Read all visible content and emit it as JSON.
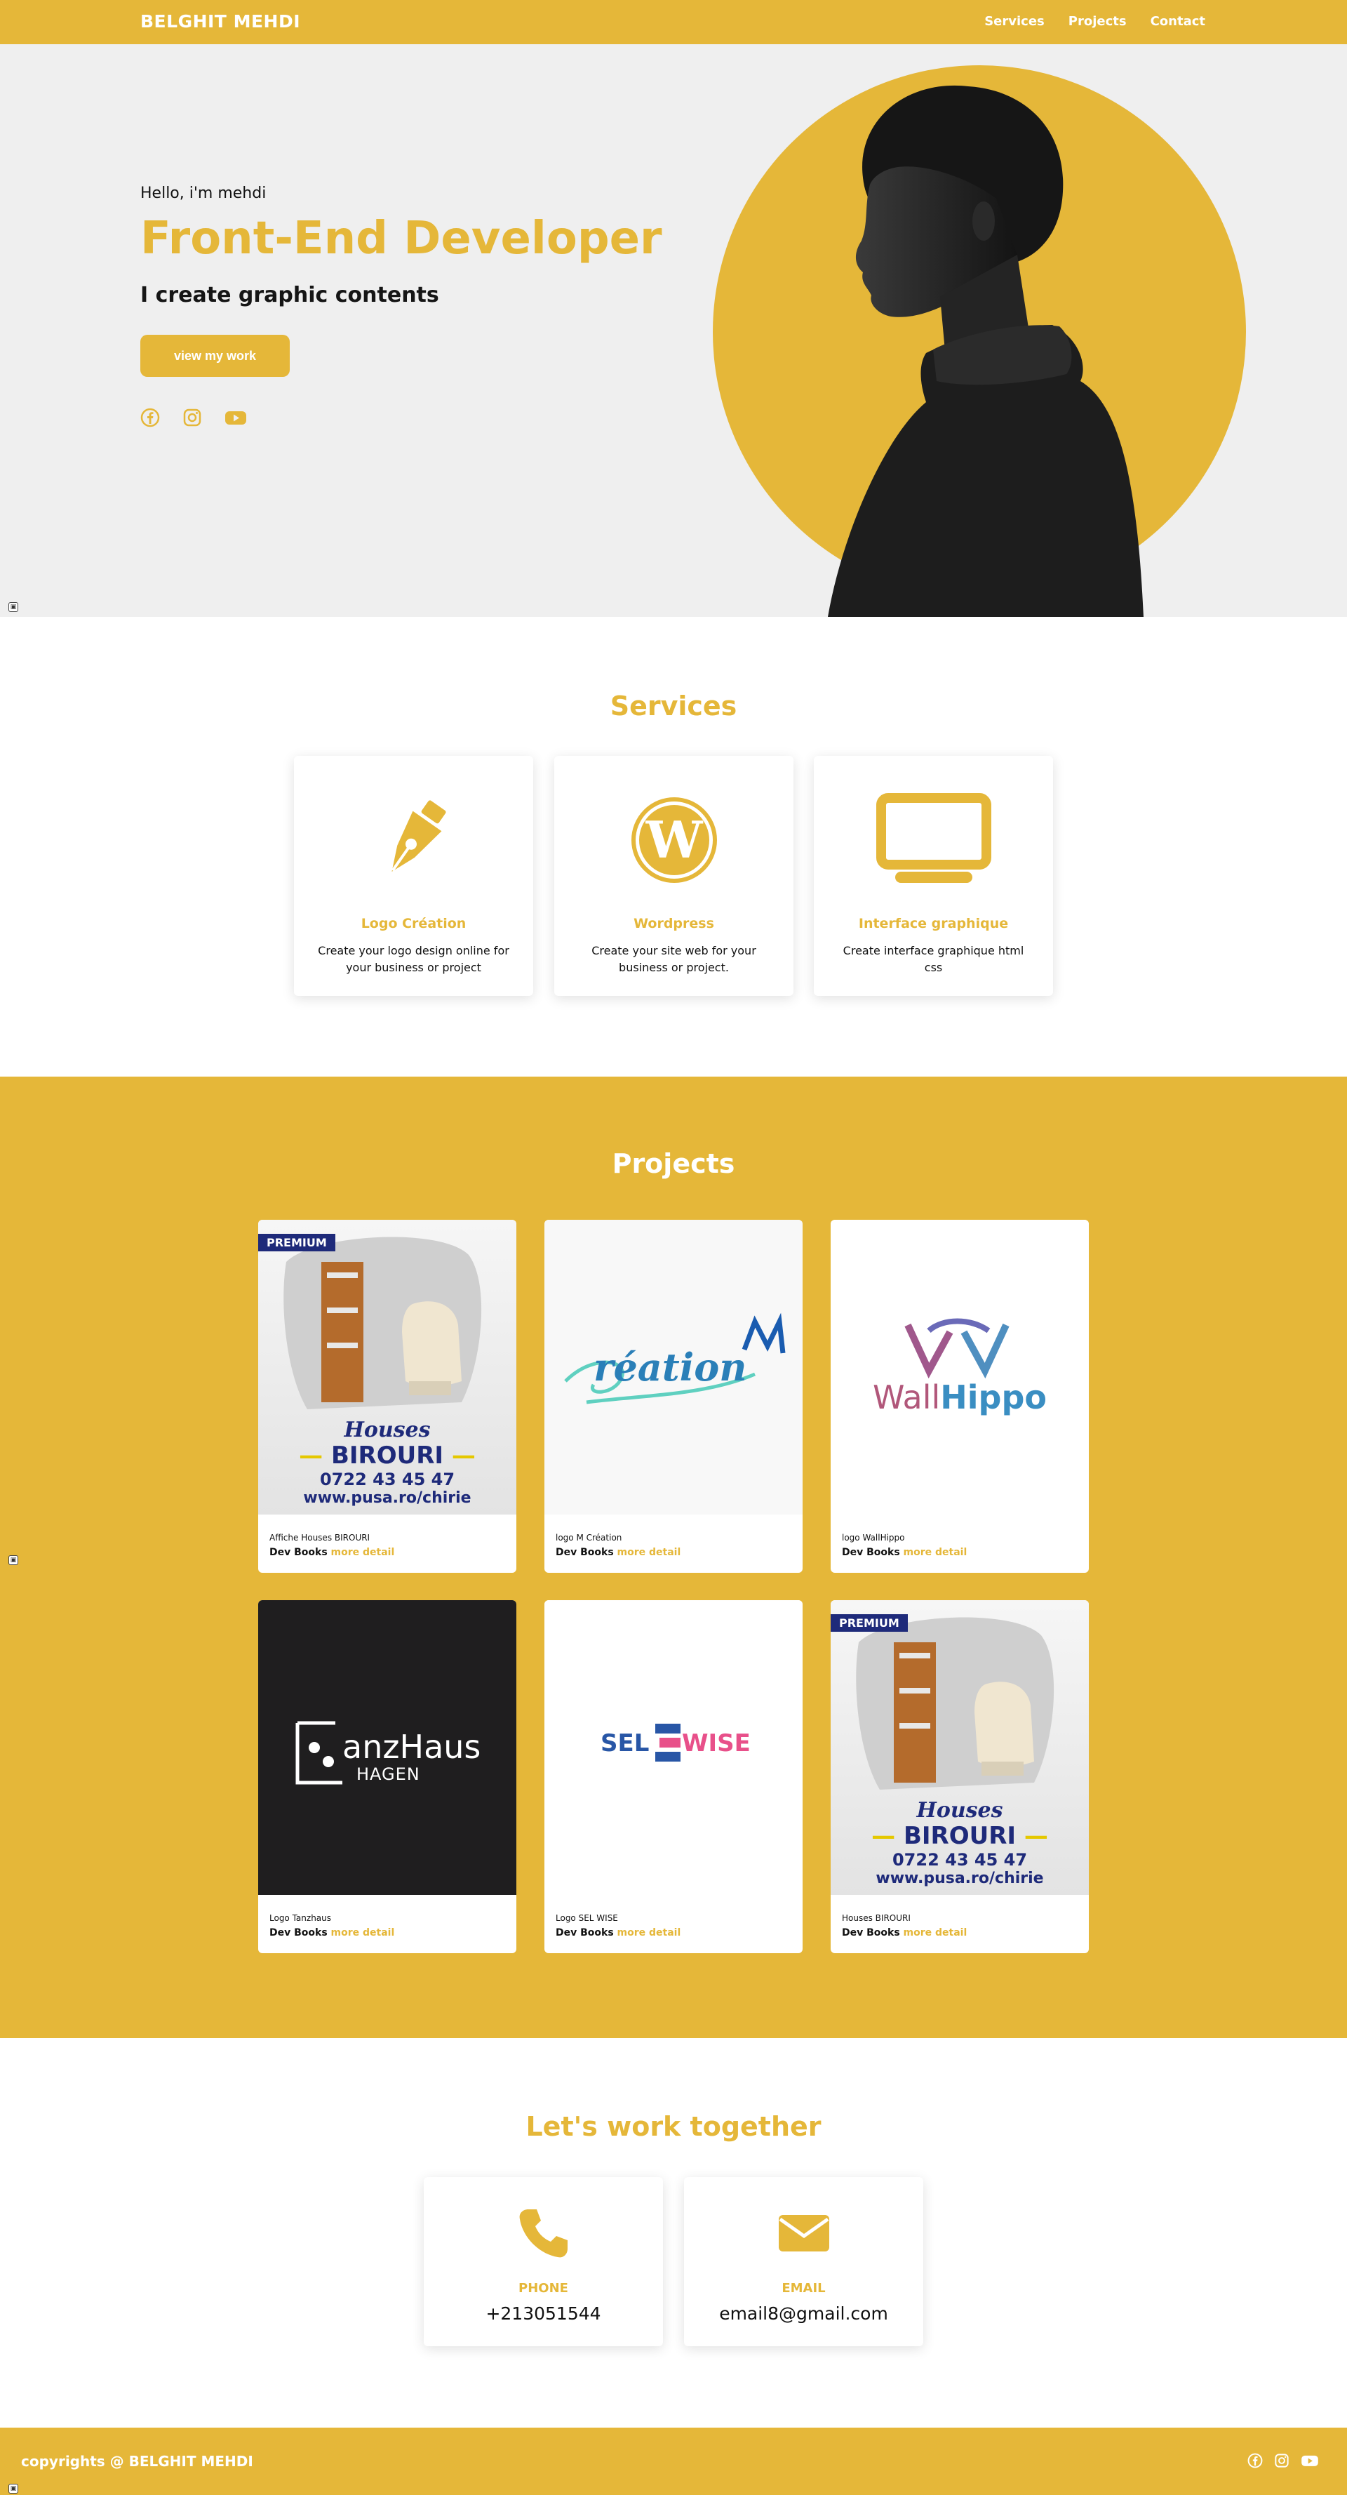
{
  "header": {
    "brand": "BELGHIT MEHDI",
    "nav": [
      "Services",
      "Projects",
      "Contact"
    ]
  },
  "hero": {
    "hello": "Hello, i'm mehdi",
    "title": "Front-End Developer",
    "subtitle": "I create graphic contents",
    "button": "view my work",
    "social_icons": [
      "facebook-icon",
      "instagram-icon",
      "youtube-icon"
    ]
  },
  "services": {
    "title": "Services",
    "cards": [
      {
        "icon": "pen-nib-icon",
        "title": "Logo Création",
        "desc": "Create your logo design online for your business or project"
      },
      {
        "icon": "wordpress-icon",
        "title": "Wordpress",
        "desc": "Create your site web for your business or project."
      },
      {
        "icon": "laptop-icon",
        "title": "Interface graphique",
        "desc": "Create interface graphique html css"
      }
    ]
  },
  "projects": {
    "title": "Projects",
    "more_label": "more detail",
    "items": [
      {
        "name": "Affiche Houses BIROURI",
        "author": "Dev Books",
        "badge": "PREMIUM",
        "art": {
          "l1": "Houses",
          "l2": "BIROURI",
          "l3": "0722 43 45 47",
          "l4": "www.pusa.ro/chirie"
        }
      },
      {
        "name": "logo M Création",
        "author": "Dev Books",
        "art": {
          "l1": "réation"
        }
      },
      {
        "name": "logo WallHippo",
        "author": "Dev Books",
        "art": {
          "l1": "Wall",
          "l2": "Hippo"
        }
      },
      {
        "name": "Logo Tanzhaus",
        "author": "Dev Books",
        "art": {
          "l1": "anzHaus",
          "l2": "HAGEN"
        }
      },
      {
        "name": "Logo SEL WISE",
        "author": "Dev Books",
        "art": {
          "l1": "SEL",
          "l2": "WISE"
        }
      },
      {
        "name": "Houses BIROURI",
        "author": "Dev Books",
        "badge": "PREMIUM",
        "art": {
          "l1": "Houses",
          "l2": "BIROURI",
          "l3": "0722 43 45 47",
          "l4": "www.pusa.ro/chirie"
        }
      }
    ]
  },
  "contact": {
    "title": "Let's work together",
    "cards": [
      {
        "icon": "phone-icon",
        "label": "PHONE",
        "value": "+213051544"
      },
      {
        "icon": "envelope-icon",
        "label": "EMAIL",
        "value": "email8@gmail.com"
      }
    ]
  },
  "footer": {
    "copyright": "copyrights @ BELGHIT MEHDI",
    "social_icons": [
      "facebook-icon",
      "instagram-icon",
      "youtube-icon"
    ]
  },
  "colors": {
    "accent": "#e5b739",
    "hero_bg": "#efefef",
    "premium": "#1e2a7a"
  }
}
